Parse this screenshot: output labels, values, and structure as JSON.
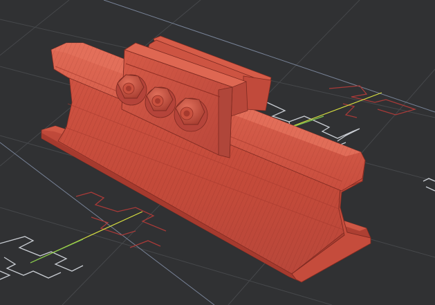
{
  "viewport": {
    "background": "#303133",
    "grid_color": "#46484b",
    "outline_color": "#c9cdd3",
    "section_color": "#a83a38",
    "axis_x_color": "#d8e040",
    "axis_y_color": "#7ec850",
    "model": {
      "name": "rail-joint-with-fishplate",
      "color_main": "#c34a3a",
      "color_light": "#d9614d",
      "color_dark": "#8f2e24",
      "wire_color": "#7e2a21",
      "bolt_count": 3
    }
  }
}
